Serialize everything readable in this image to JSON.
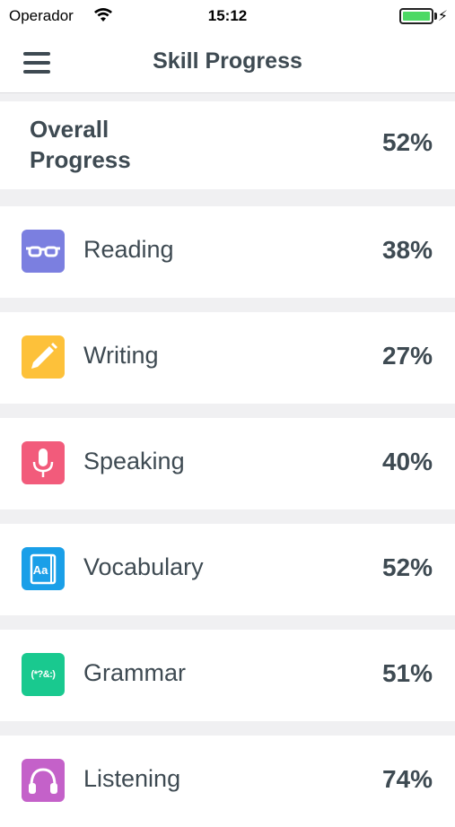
{
  "status_bar": {
    "carrier": "Operador",
    "time": "15:12",
    "battery_color": "#4cd964"
  },
  "nav": {
    "title": "Skill Progress",
    "menu_icon": "hamburger-menu-icon"
  },
  "overall": {
    "label": "Overall Progress",
    "value": "52%"
  },
  "skills": [
    {
      "name": "Reading",
      "value": "38%",
      "icon": "glasses-icon",
      "color": "#7b7fe0"
    },
    {
      "name": "Writing",
      "value": "27%",
      "icon": "pencil-icon",
      "color": "#fdc13a"
    },
    {
      "name": "Speaking",
      "value": "40%",
      "icon": "microphone-icon",
      "color": "#f25b7b"
    },
    {
      "name": "Vocabulary",
      "value": "52%",
      "icon": "book-icon",
      "icon_text": "Aa",
      "color": "#1a9fe8"
    },
    {
      "name": "Grammar",
      "value": "51%",
      "icon": "grammar-symbols-icon",
      "icon_text": "(*?&:)",
      "color": "#19c98f"
    },
    {
      "name": "Listening",
      "value": "74%",
      "icon": "headphones-icon",
      "color": "#c461c9"
    }
  ]
}
